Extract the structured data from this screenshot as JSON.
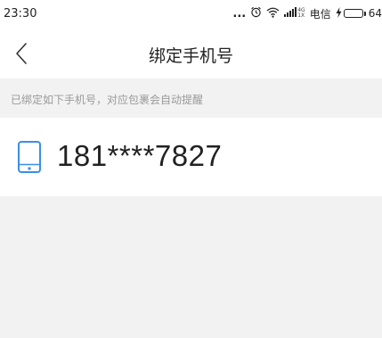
{
  "status_bar": {
    "time": "23:30",
    "dots": "...",
    "network_top": "4G",
    "network_bottom": "1X",
    "carrier": "电信",
    "battery_percent_text": "64",
    "battery_level": 0.64,
    "icons": [
      "alarm-icon",
      "wifi-icon",
      "signal-icon",
      "charging-icon",
      "battery-icon"
    ]
  },
  "nav": {
    "title": "绑定手机号",
    "back_icon": "chevron-left-icon"
  },
  "hint": {
    "text": "已绑定如下手机号，对应包裹会自动提醒"
  },
  "phone": {
    "number": "181****7827",
    "icon": "phone-icon",
    "accent_color": "#3a8ee6"
  }
}
